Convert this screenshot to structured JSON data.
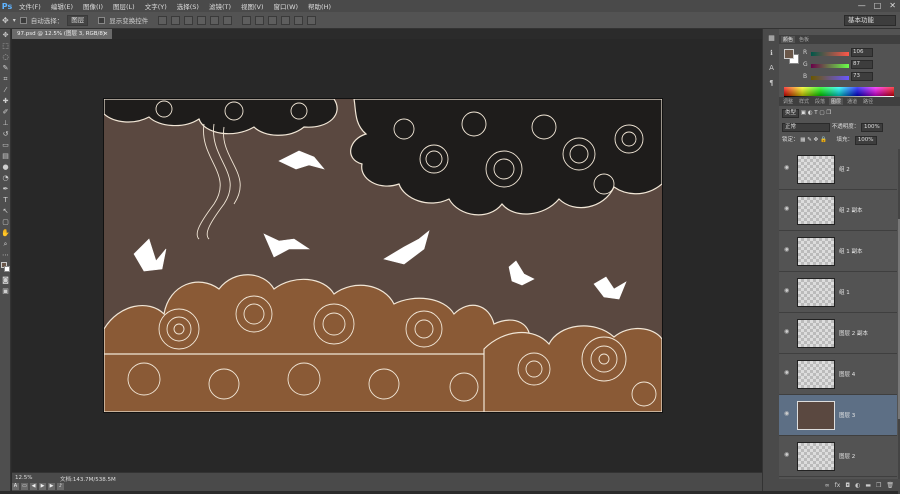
{
  "app": {
    "logo": "Ps"
  },
  "menu": [
    "文件(F)",
    "编辑(E)",
    "图像(I)",
    "图层(L)",
    "文字(Y)",
    "选择(S)",
    "滤镜(T)",
    "视图(V)",
    "窗口(W)",
    "帮助(H)"
  ],
  "window_controls": {
    "minimize": "—",
    "maximize": "□",
    "close": "✕"
  },
  "options_bar": {
    "auto_select_label": "自动选择：",
    "auto_select_value": "图层",
    "show_transform_label": "显示变换控件",
    "workspace": "基本功能"
  },
  "document": {
    "tab_title": "97.psd @ 12.5% (图层 3, RGB/8)",
    "tab_close": "×"
  },
  "status": {
    "zoom": "12.5%",
    "doc_info": "文档:143.7M/538.5M"
  },
  "panels": {
    "color": {
      "tabs": [
        "颜色",
        "色板"
      ],
      "channels": [
        {
          "label": "R",
          "value": "106"
        },
        {
          "label": "G",
          "value": "87"
        },
        {
          "label": "B",
          "value": "73"
        }
      ],
      "foreground": "#6a5749",
      "background": "#ffffff"
    },
    "layers": {
      "tabs": [
        "调整",
        "样式",
        "段落",
        "图层",
        "通道",
        "路径"
      ],
      "filter_kind": "类型",
      "blend_mode": "正常",
      "opacity_label": "不透明度：",
      "opacity_value": "100%",
      "lock_label": "锁定：",
      "fill_label": "填充：",
      "fill_value": "100%",
      "items": [
        {
          "name": "组 2",
          "selected": false
        },
        {
          "name": "组 2 副本",
          "selected": false
        },
        {
          "name": "组 1 副本",
          "selected": false
        },
        {
          "name": "组 1",
          "selected": false
        },
        {
          "name": "图层 2 副本",
          "selected": false
        },
        {
          "name": "图层 4",
          "selected": false
        },
        {
          "name": "图层 3",
          "selected": true
        },
        {
          "name": "图层 2",
          "selected": false
        }
      ]
    }
  },
  "canvas_colors": {
    "sky": "#5a4840",
    "dark_cloud": "#1e1c1b",
    "brown_cloud": "#8a5a36",
    "line": "#f1e6d6"
  }
}
